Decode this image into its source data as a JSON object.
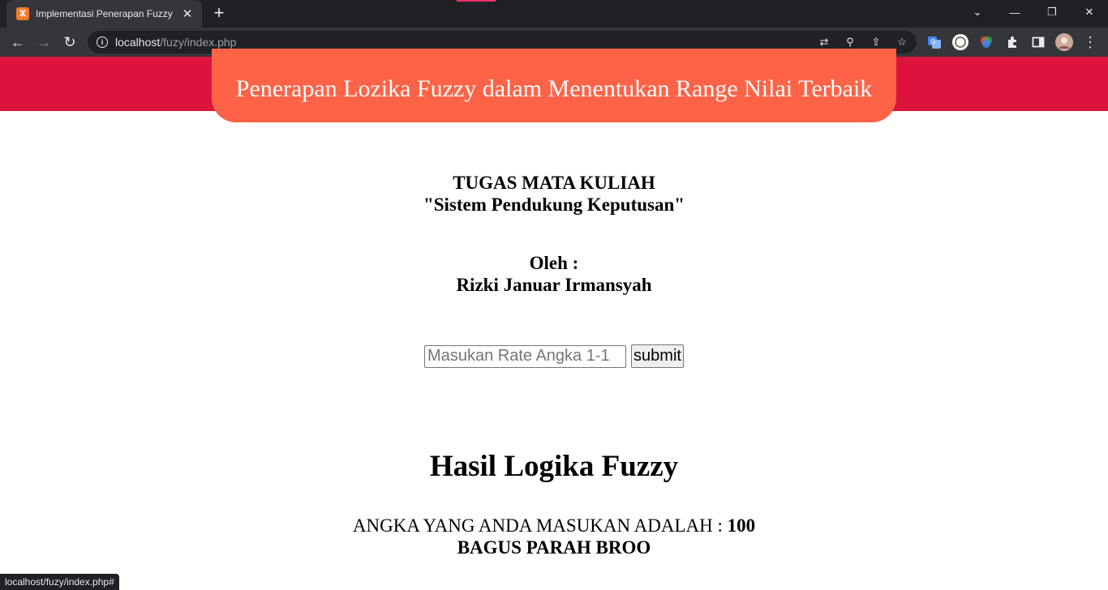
{
  "browser": {
    "tab_title": "Implementasi Penerapan Fuzzy",
    "tab_favicon": "xampp-icon",
    "url_host": "localhost",
    "url_path": "/fuzy/index.php",
    "status_url": "localhost/fuzy/index.php#",
    "accent_color": "#35363a"
  },
  "page": {
    "banner_title": "Penerapan Lozika Fuzzy dalam Menentukan Range Nilai Terbaik",
    "banner_color": "#dc143c",
    "pill_color": "#ff6347",
    "course_line1": "TUGAS MATA KULIAH",
    "course_line2": "\"Sistem Pendukung Keputusan\"",
    "by_label": "Oleh :",
    "author": "Rizki Januar Irmansyah",
    "input_placeholder": "Masukan Rate Angka 1-1",
    "input_value": "",
    "submit_label": "submit",
    "result_heading": "Hasil Logika Fuzzy",
    "result_prefix": "ANGKA YANG ANDA MASUKAN ADALAH :",
    "result_value": "100",
    "result_verdict": "BAGUS PARAH BROO"
  }
}
